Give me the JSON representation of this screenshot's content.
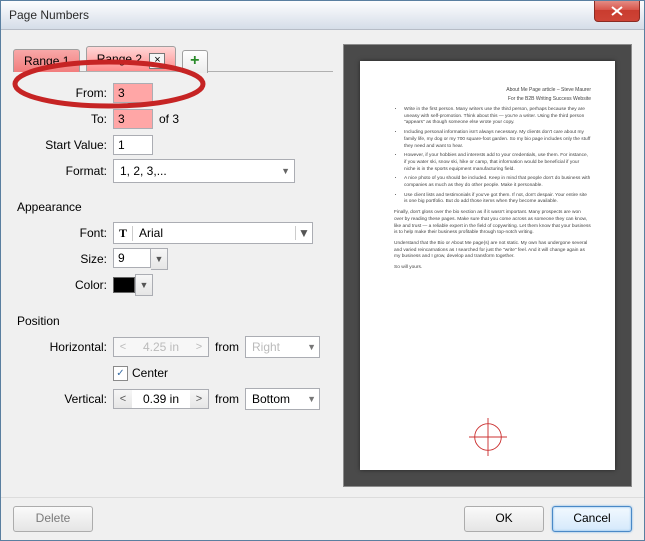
{
  "window": {
    "title": "Page Numbers",
    "close_icon": "close"
  },
  "tabs": {
    "items": [
      {
        "label": "Range 1",
        "active": false
      },
      {
        "label": "Range 2",
        "active": true,
        "closable": true
      }
    ],
    "add_label": "+"
  },
  "range": {
    "from_label": "From:",
    "from_value": "3",
    "to_label": "To:",
    "to_value": "3",
    "of_text": "of 3",
    "start_label": "Start Value:",
    "start_value": "1",
    "format_label": "Format:",
    "format_value": "1, 2, 3,..."
  },
  "appearance": {
    "heading": "Appearance",
    "font_label": "Font:",
    "font_value": "Arial",
    "size_label": "Size:",
    "size_value": "9",
    "color_label": "Color:",
    "color_value": "#000000"
  },
  "position": {
    "heading": "Position",
    "h_label": "Horizontal:",
    "h_value": "4.25 in",
    "h_from": "Right",
    "center_label": "Center",
    "center_checked": true,
    "v_label": "Vertical:",
    "v_value": "0.39 in",
    "v_from": "Bottom",
    "from_text": "from"
  },
  "footer": {
    "delete": "Delete",
    "ok": "OK",
    "cancel": "Cancel"
  },
  "preview": {
    "title1": "About Me Page article – Steve Maurer",
    "title2": "For the B2B Writing Success Website",
    "bullets": [
      "Write in the first person. Many writers use the third person, perhaps because they are uneasy with self-promotion. Think about this — you're a writer. Using the third person \"appears\" as though someone else wrote your copy.",
      "Including personal information isn't always necessary. My clients don't care about my family life, my dog or my 700 square-foot garden. So my bio page includes only the stuff they need and want to hear.",
      "However, if your hobbies and interests add to your credentials, use them. For instance, if you water ski, snow ski, hike or camp, that information would be beneficial if your niche is in the sports equipment manufacturing field.",
      "A nice photo of you should be included. Keep in mind that people don't do business with companies as much as they do other people. Make it personable.",
      "Use client lists and testimonials if you've got them. If not, don't despair. Your entire site is one big portfolio. But do add those items when they become available."
    ],
    "p1": "Finally, don't gloss over the bio section as if it wasn't important. Many prospects are won over by reading these pages. Make sure that you come across as someone they can know, like and trust — a reliable expert in the field of copywriting. Let them know that your business is to help make their business profitable through top-notch writing.",
    "p2": "Understand that the Bio or About Me page(s) are not static. My own has undergone several and varied reincarnations as I searched for just the \"write\" feel. And it will change again as my business and I grow, develop and transform together.",
    "p3": "So will yours."
  }
}
